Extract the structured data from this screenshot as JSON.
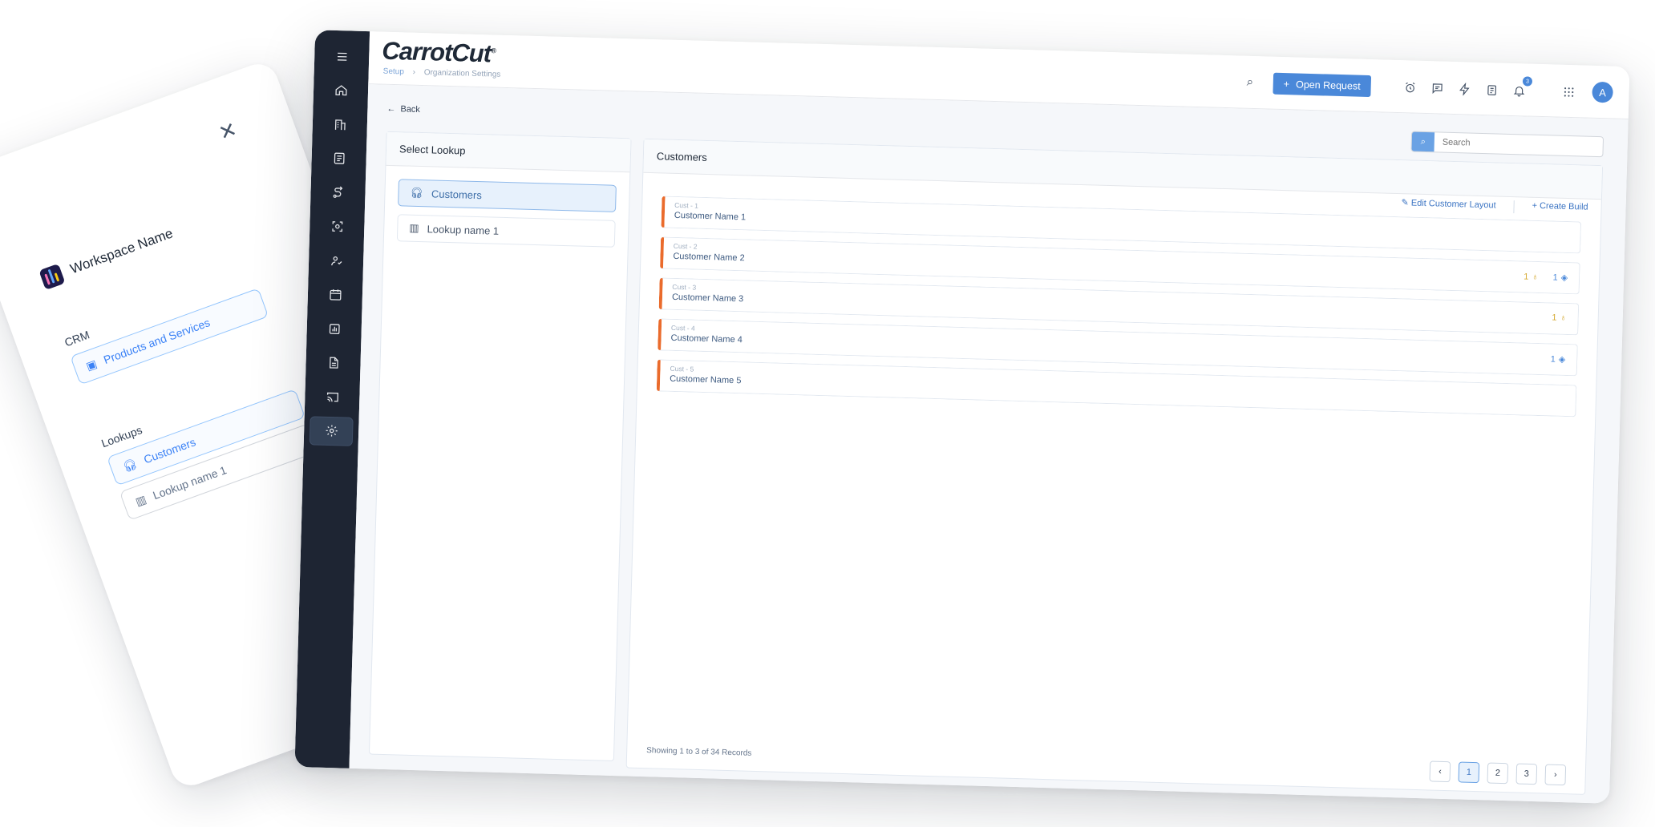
{
  "drawer": {
    "workspace_name": "Workspace Name",
    "crm_label": "CRM",
    "crm_item": "Products and Services",
    "lookups_label": "Lookups",
    "lookup_items": [
      "Customers",
      "Lookup name 1"
    ]
  },
  "app": {
    "logo": "CarrotCut",
    "breadcrumb": [
      "Setup",
      "›",
      "Organization Settings"
    ],
    "open_request_label": "Open Request",
    "notification_count": "3",
    "avatar_initial": "A"
  },
  "sidebar_icons": [
    "menu-icon",
    "home-icon",
    "building-icon",
    "ledger-icon",
    "route-icon",
    "scan-icon",
    "team-icon",
    "calendar-icon",
    "report-icon",
    "document-icon",
    "cast-icon",
    "settings-icon"
  ],
  "content": {
    "back_label": "Back",
    "search_placeholder": "Search",
    "left_panel_title": "Select Lookup",
    "lookups": [
      "Customers",
      "Lookup name 1"
    ],
    "right_panel_title": "Customers",
    "edit_layout_label": "Edit Customer Layout",
    "create_build_label": "Create Build",
    "customers": [
      {
        "id": "Cust - 1",
        "name": "Customer Name 1",
        "bulbs": "",
        "tags": ""
      },
      {
        "id": "Cust - 2",
        "name": "Customer Name 2",
        "bulbs": "1",
        "tags": "1"
      },
      {
        "id": "Cust - 3",
        "name": "Customer Name 3",
        "bulbs": "1",
        "tags": ""
      },
      {
        "id": "Cust - 4",
        "name": "Customer Name 4",
        "bulbs": "",
        "tags": "1"
      },
      {
        "id": "Cust - 5",
        "name": "Customer Name 5",
        "bulbs": "",
        "tags": ""
      }
    ],
    "showing_text": "Showing 1 to 3 of 34 Records",
    "pages": [
      "1",
      "2",
      "3"
    ]
  },
  "colors": {
    "sidebar": "#1e2533",
    "accent": "#4a88d9",
    "row_marker": "#ea6b2c"
  }
}
